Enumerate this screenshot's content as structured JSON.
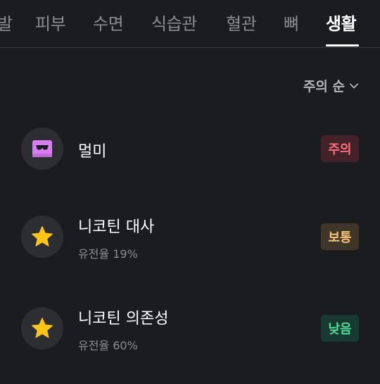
{
  "tabs": [
    {
      "label": "발"
    },
    {
      "label": "피부"
    },
    {
      "label": "수면"
    },
    {
      "label": "식습관"
    },
    {
      "label": "혈관"
    },
    {
      "label": "뼈"
    },
    {
      "label": "생활",
      "active": true
    }
  ],
  "sort": {
    "label": "주의 순",
    "icon": "chevron-down-icon"
  },
  "items": [
    {
      "title": "멀미",
      "subtitle": "",
      "icon": "motion-sickness-icon",
      "badge": "주의",
      "level": "caution",
      "color": "#ff6d7e"
    },
    {
      "title": "니코틴 대사",
      "subtitle": "유전율 19%",
      "icon": "star-icon",
      "badge": "보통",
      "level": "normal",
      "color": "#f6c27a"
    },
    {
      "title": "니코틴 의존성",
      "subtitle": "유전율 60%",
      "icon": "star-icon",
      "badge": "낮음",
      "level": "low",
      "color": "#4fdc9a"
    }
  ],
  "colors": {
    "background": "#1b1c1f",
    "accent": "#ffffff",
    "star": "#fcc419",
    "motion_icon": "#d77ef0"
  }
}
